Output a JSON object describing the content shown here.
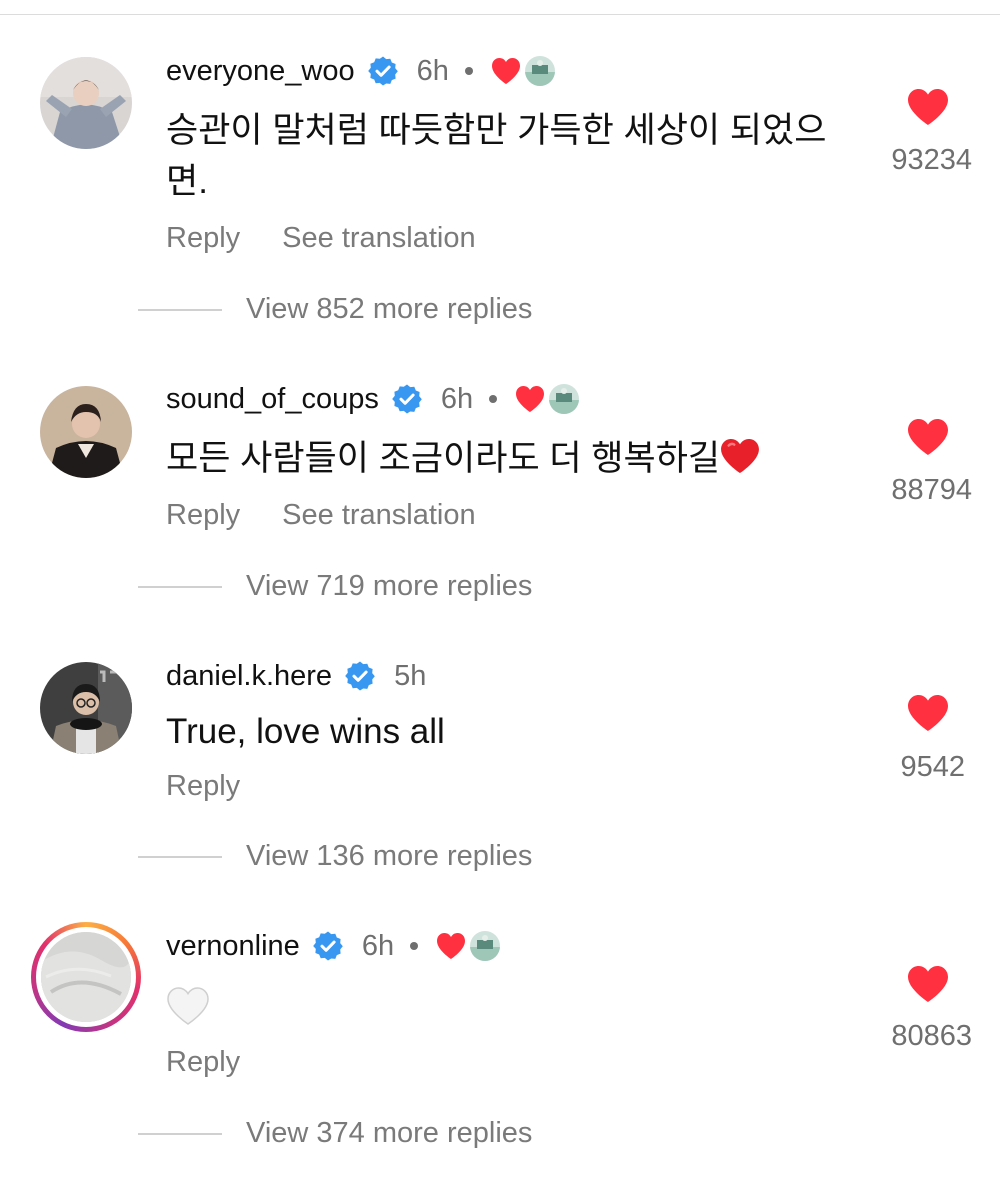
{
  "comments": [
    {
      "username": "everyone_woo",
      "time": "6h",
      "text": "승관이 말처럼 따듯함만 가득한 세상이 되었으면.",
      "reply_label": "Reply",
      "translation_label": "See translation",
      "likes": "93234",
      "replies_label": "View 852 more replies"
    },
    {
      "username": "sound_of_coups",
      "time": "6h",
      "text": "모든 사람들이 조금이라도 더 행복하길",
      "reply_label": "Reply",
      "translation_label": "See translation",
      "likes": "88794",
      "replies_label": "View 719 more replies"
    },
    {
      "username": "daniel.k.here",
      "time": "5h",
      "text": "True, love wins all",
      "reply_label": "Reply",
      "likes": "9542",
      "replies_label": "View 136 more replies"
    },
    {
      "username": "vernonline",
      "time": "6h",
      "text": "",
      "reply_label": "Reply",
      "likes": "80863",
      "replies_label": "View 374 more replies"
    }
  ],
  "icons": {
    "verified": "verified-badge-icon",
    "like": "heart-icon",
    "creator_liked": "red-heart-icon",
    "white_heart_emoji": "white-heart-icon",
    "red_heart_emoji": "red-heart-emoji-icon"
  },
  "colors": {
    "verified_blue": "#3897f0",
    "like_red": "#ff3040",
    "secondary_text": "#7a7a7a",
    "primary_text": "#111111"
  }
}
